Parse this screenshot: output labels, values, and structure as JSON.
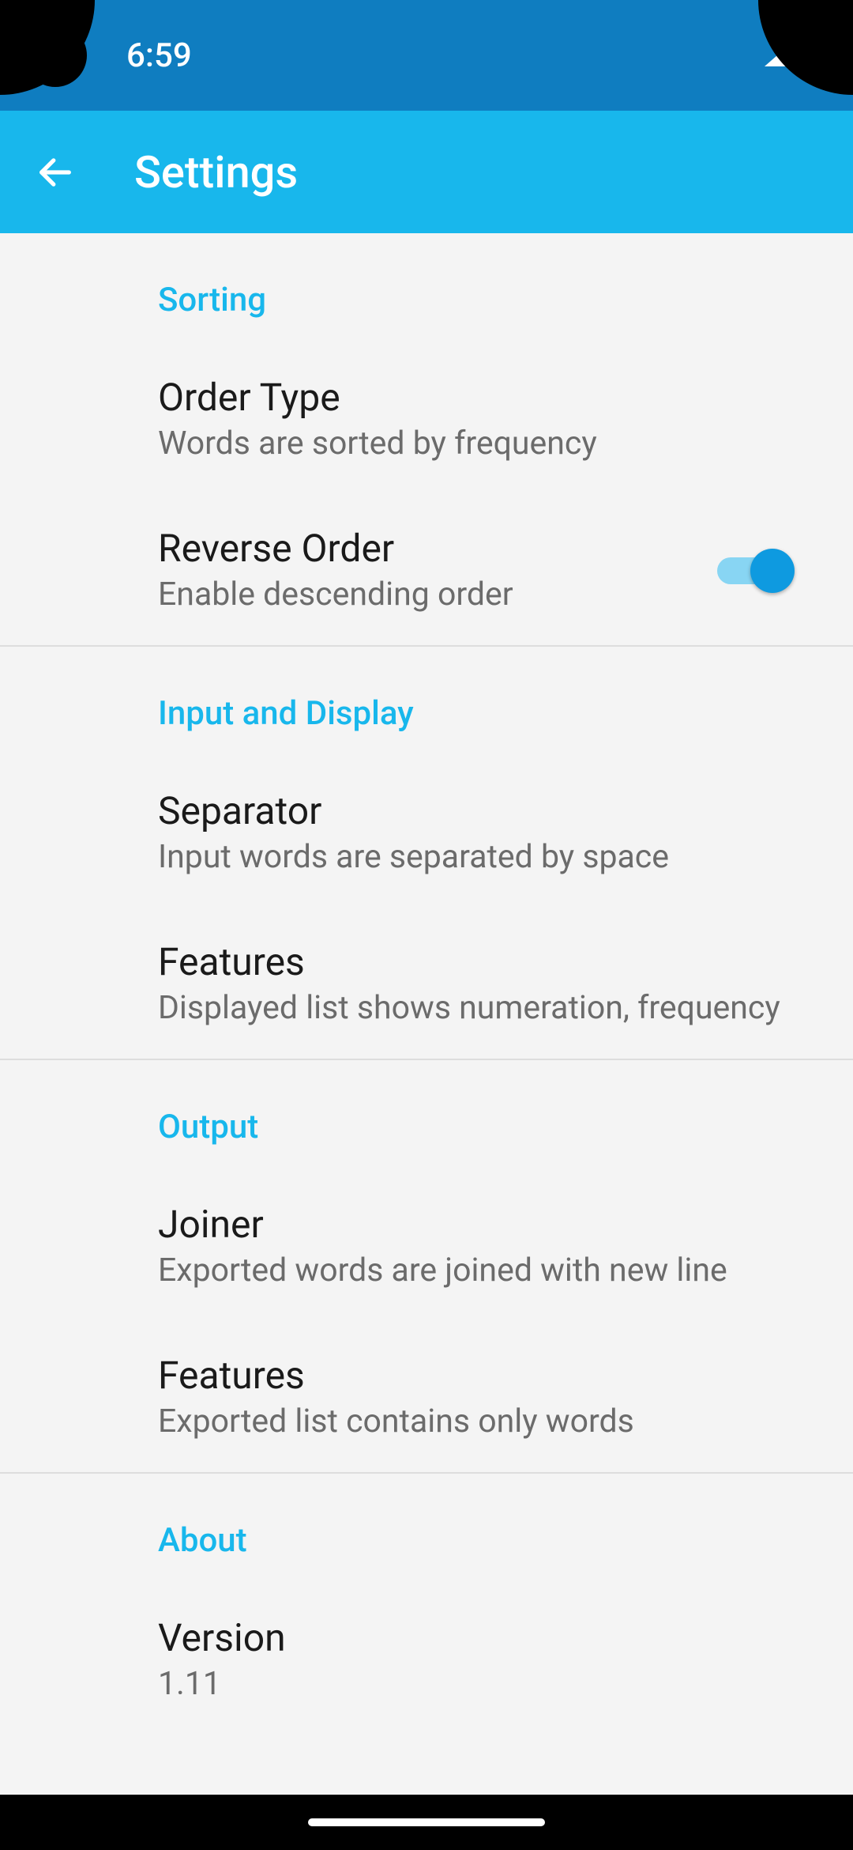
{
  "status": {
    "time": "6:59"
  },
  "appbar": {
    "title": "Settings"
  },
  "sections": {
    "sorting": {
      "header": "Sorting",
      "order_type": {
        "title": "Order Type",
        "sub": "Words are sorted by frequency"
      },
      "reverse_order": {
        "title": "Reverse Order",
        "sub": "Enable descending order",
        "on": true
      }
    },
    "input_display": {
      "header": "Input and Display",
      "separator": {
        "title": "Separator",
        "sub": "Input words are separated by space"
      },
      "features": {
        "title": "Features",
        "sub": "Displayed list shows numeration, frequency"
      }
    },
    "output": {
      "header": "Output",
      "joiner": {
        "title": "Joiner",
        "sub": "Exported words are joined with new line"
      },
      "features": {
        "title": "Features",
        "sub": "Exported list contains only words"
      }
    },
    "about": {
      "header": "About",
      "version": {
        "title": "Version",
        "sub": "1.11"
      }
    }
  }
}
